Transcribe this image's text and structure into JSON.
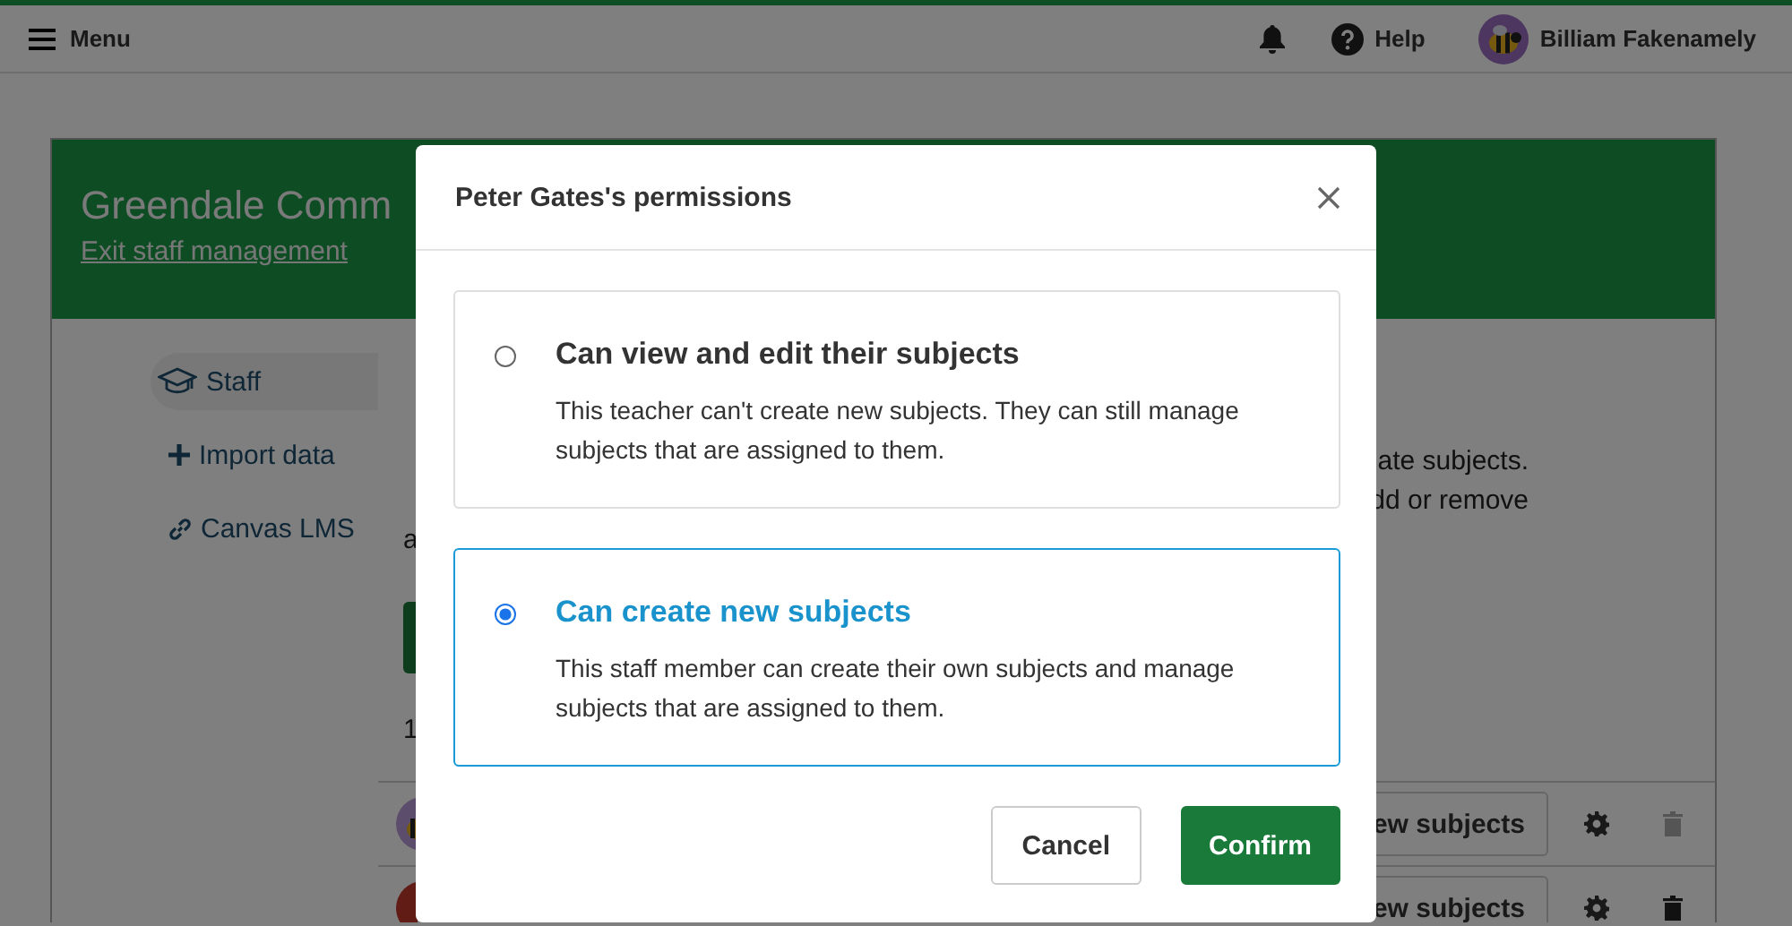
{
  "top_bar": {
    "menu_label": "Menu",
    "help_label": "Help",
    "user_name": "Billiam Fakenamely"
  },
  "banner": {
    "title": "Greendale Comm",
    "exit_link": "Exit staff management"
  },
  "sidebar": {
    "items": [
      {
        "label": "Staff",
        "selected": true
      },
      {
        "label": "Import data",
        "selected": false
      },
      {
        "label": "Canvas LMS",
        "selected": false
      }
    ]
  },
  "main": {
    "paragraph_lines": [
      {
        "right": "ate subjects."
      },
      {
        "right": "dd or remove"
      },
      {
        "left": "a"
      }
    ],
    "count": "1",
    "rows": [
      {
        "button": "ew subjects",
        "delete_disabled": true
      },
      {
        "button": "ew subjects",
        "delete_disabled": false
      }
    ]
  },
  "dialog": {
    "title": "Peter Gates's permissions",
    "options": [
      {
        "title": "Can view and edit their subjects",
        "description": "This teacher can't create new subjects. They can still manage subjects that are assigned to them.",
        "selected": false
      },
      {
        "title": "Can create new subjects",
        "description": "This staff member can create their own subjects and manage subjects that are assigned to them.",
        "selected": true
      }
    ],
    "buttons": [
      {
        "label": "Cancel",
        "kind": "secondary"
      },
      {
        "label": "Confirm",
        "kind": "primary"
      }
    ]
  }
}
